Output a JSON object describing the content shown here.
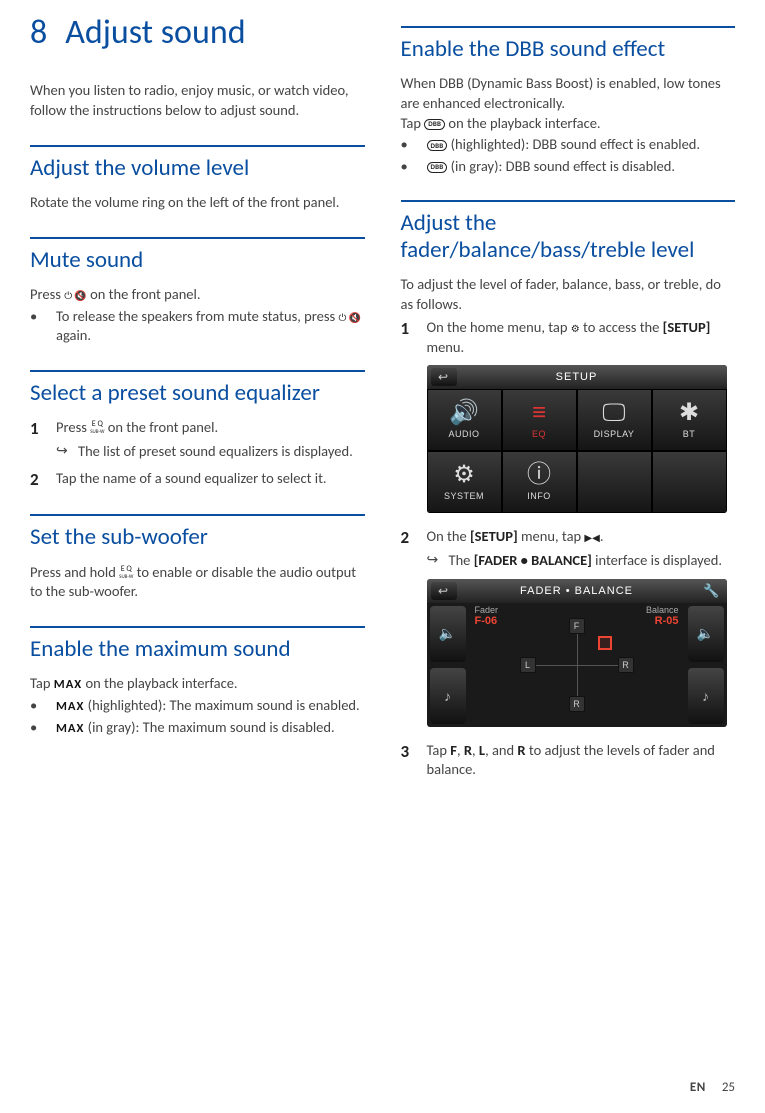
{
  "chapter": {
    "num": "8",
    "title": "Adjust sound"
  },
  "intro": "When you listen to radio, enjoy music, or watch video, follow the instructions below to adjust sound.",
  "volume": {
    "heading": "Adjust the volume level",
    "body": "Rotate the volume ring on the left of the front panel."
  },
  "mute": {
    "heading": "Mute sound",
    "press_pre": "Press ",
    "press_post": " on the front panel.",
    "bullet_pre": "To release the speakers from mute status, press ",
    "bullet_post": " again."
  },
  "eq": {
    "heading": "Select a preset sound equalizer",
    "step1_pre": "Press ",
    "step1_post": " on the front panel.",
    "step1_sub": "The list of preset sound equalizers is displayed.",
    "step2": "Tap the name of a sound equalizer to select it."
  },
  "subwoofer": {
    "heading": "Set the sub-woofer",
    "body_pre": "Press and hold ",
    "body_post": " to enable or disable the audio output to the sub-woofer."
  },
  "max": {
    "heading": "Enable the maximum sound",
    "tap_pre": "Tap ",
    "tap_post": " on the playback interface.",
    "b1_post": " (highlighted): The maximum sound is enabled.",
    "b2_post": " (in gray): The maximum sound is disabled."
  },
  "dbb": {
    "heading": "Enable the DBB sound effect",
    "p1": "When DBB (Dynamic Bass Boost) is enabled, low tones are enhanced electronically.",
    "tap_pre": "Tap ",
    "tap_post": " on the playback interface.",
    "b1_post": " (highlighted): DBB sound effect is enabled.",
    "b2_post": " (in gray): DBB sound effect is disabled."
  },
  "fader": {
    "heading": "Adjust the fader/balance/bass/treble level",
    "intro": "To adjust the level of fader, balance, bass, or treble, do as follows.",
    "step1_pre": "On the home menu, tap ",
    "step1_mid": " to access the ",
    "step1_setup": "[SETUP]",
    "step1_post": " menu.",
    "step2_pre": "On the ",
    "step2_setup": "[SETUP]",
    "step2_mid": " menu, tap ",
    "step2_post": ".",
    "step2_sub_pre": "The ",
    "step2_sub_bold": "[FADER • BALANCE]",
    "step2_sub_post": " interface is displayed.",
    "step3_pre": "Tap ",
    "step3_mid1": ", ",
    "step3_mid2": ", ",
    "step3_mid3": ", and ",
    "step3_post": " to adjust the levels of fader and balance.",
    "keys": {
      "F": "F",
      "R": "R",
      "L": "L",
      "R2": "R"
    }
  },
  "setup_screen": {
    "title": "SETUP",
    "cells": [
      "AUDIO",
      "EQ",
      "DISPLAY",
      "BT",
      "SYSTEM",
      "INFO"
    ]
  },
  "fb_screen": {
    "title": "FADER • BALANCE",
    "fader_label": "Fader",
    "fader_val": "F-06",
    "balance_label": "Balance",
    "balance_val": "R-05",
    "F": "F",
    "R": "R",
    "L": "L"
  },
  "footer": {
    "lang": "EN",
    "page": "25"
  },
  "icons": {
    "dbb": "DBB",
    "max": "MAX",
    "eq_top": "E Q",
    "eq_bot": "SUB-W"
  }
}
